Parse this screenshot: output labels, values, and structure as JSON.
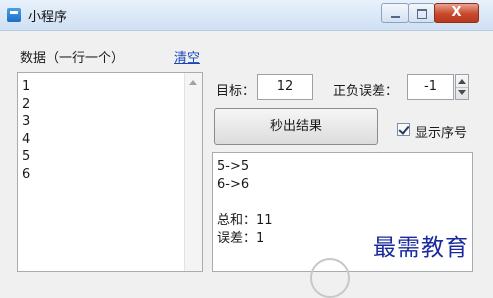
{
  "window": {
    "title": "小程序",
    "close_label": "X"
  },
  "data_panel": {
    "label": "数据（一行一个）",
    "clear_link": "清空",
    "lines": [
      "1",
      "2",
      "3",
      "4",
      "5",
      "6"
    ]
  },
  "controls": {
    "target_label": "目标：",
    "target_value": "12",
    "error_label": "正负误差：",
    "error_value": "-1",
    "run_button": "秒出结果",
    "show_index_label": "显示序号",
    "show_index_checked": true
  },
  "result": {
    "lines": [
      "5->5",
      "6->6",
      "",
      "总和：11",
      "误差：1"
    ]
  },
  "watermark": {
    "text": "最需教育"
  }
}
